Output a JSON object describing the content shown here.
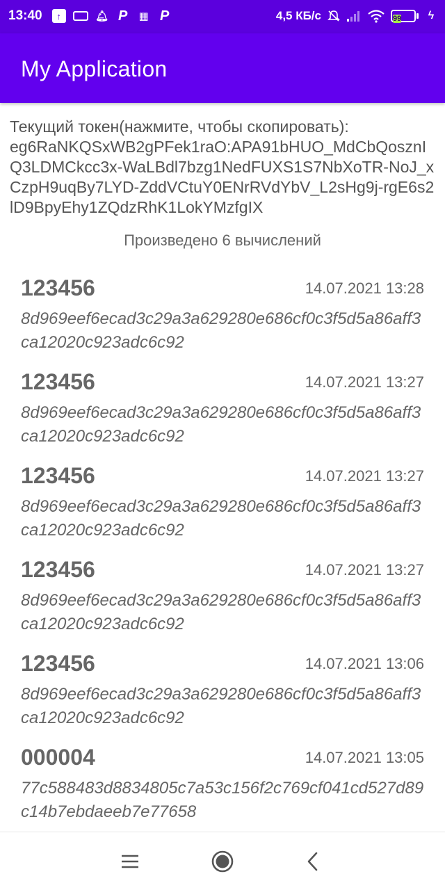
{
  "status_bar": {
    "time": "13:40",
    "left_icons": [
      "upload-icon",
      "cassette-icon",
      "bell-icon",
      "p-icon",
      "sim-icon",
      "p-icon"
    ],
    "network_speed": "4,5 КБ/с",
    "battery_level": "99",
    "right_icons": [
      "bell-off-icon",
      "signal-icon",
      "wifi-icon",
      "battery-icon",
      "charging-icon"
    ]
  },
  "app_bar": {
    "title": "My Application"
  },
  "token": {
    "label": "Текущий токен(нажмите, чтобы скопировать):",
    "value": "eg6RaNKQSxWB2gPFek1raO:APA91bHUO_MdCbQosznIQ3LDMCkcc3x-WaLBdl7bzg1NedFUXS1S7NbXoTR-NoJ_xCzpH9uqBy7LYD-ZddVCtuY0ENrRVdYbV_L2sHg9j-rgE6s2lD9BpyEhy1ZQdzRhK1LokYMzfgIX"
  },
  "count_label": "Произведено 6 вычислений",
  "items": [
    {
      "code": "123456",
      "date": "14.07.2021 13:28",
      "hash": "8d969eef6ecad3c29a3a629280e686cf0c3f5d5a86aff3ca12020c923adc6c92"
    },
    {
      "code": "123456",
      "date": "14.07.2021 13:27",
      "hash": "8d969eef6ecad3c29a3a629280e686cf0c3f5d5a86aff3ca12020c923adc6c92"
    },
    {
      "code": "123456",
      "date": "14.07.2021 13:27",
      "hash": "8d969eef6ecad3c29a3a629280e686cf0c3f5d5a86aff3ca12020c923adc6c92"
    },
    {
      "code": "123456",
      "date": "14.07.2021 13:27",
      "hash": "8d969eef6ecad3c29a3a629280e686cf0c3f5d5a86aff3ca12020c923adc6c92"
    },
    {
      "code": "123456",
      "date": "14.07.2021 13:06",
      "hash": "8d969eef6ecad3c29a3a629280e686cf0c3f5d5a86aff3ca12020c923adc6c92"
    },
    {
      "code": "000004",
      "date": "14.07.2021 13:05",
      "hash": "77c588483d8834805c7a53c156f2c769cf041cd527d89c14b7ebdaeeb7e77658"
    }
  ],
  "nav_bar": {
    "buttons": [
      "menu-icon",
      "home-icon",
      "back-icon"
    ]
  },
  "colors": {
    "status_bar": "#5b00dd",
    "app_bar": "#6200ee",
    "text": "#666666",
    "battery_fill": "#a5e84a"
  }
}
